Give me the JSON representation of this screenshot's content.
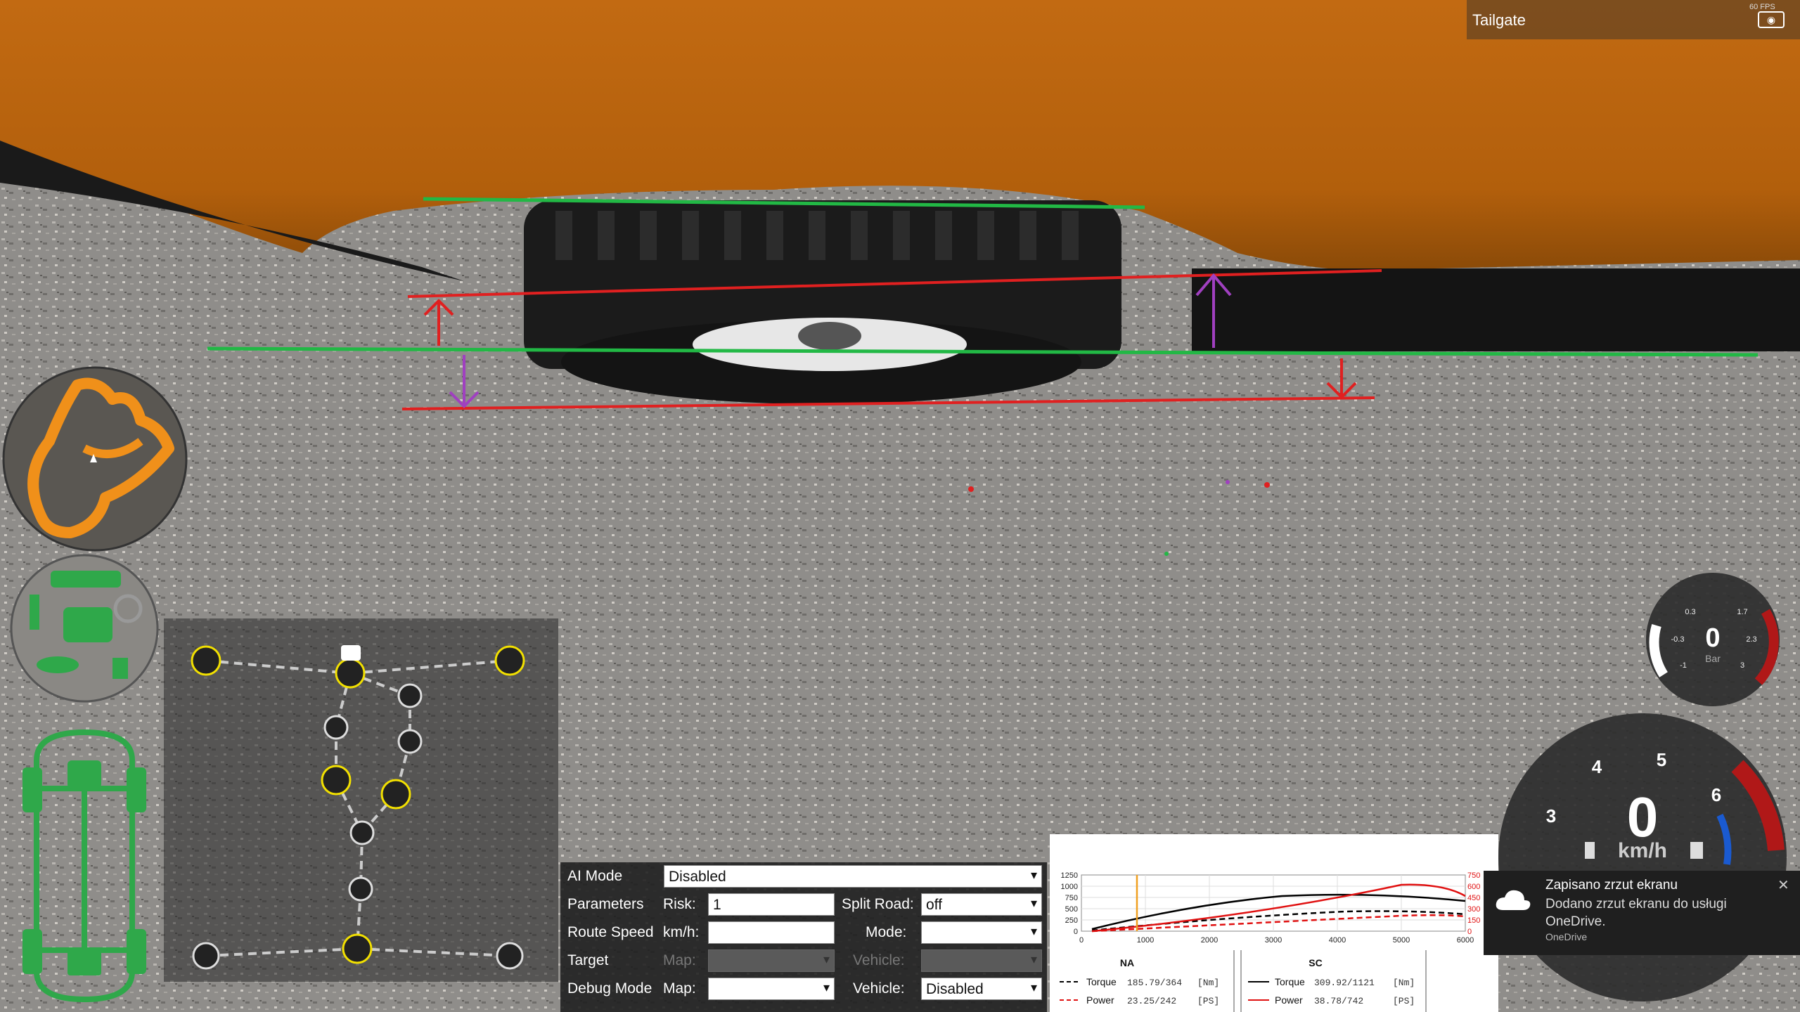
{
  "window": {
    "tailgate_label": "Tailgate",
    "fps_text": "60 FPS",
    "screenshot_icon": "camera-icon"
  },
  "debug_panel": {
    "ai_mode_label": "AI Mode",
    "ai_mode_value": "Disabled",
    "parameters_label": "Parameters",
    "risk_label": "Risk:",
    "risk_value": "1",
    "split_road_label": "Split Road:",
    "split_road_value": "off",
    "route_speed_label": "Route Speed",
    "kmh_label": "km/h:",
    "kmh_value": "",
    "mode_label": "Mode:",
    "mode_value": "",
    "target_label": "Target",
    "target_map_label": "Map:",
    "target_map_value": "",
    "target_vehicle_label": "Vehicle:",
    "target_vehicle_value": "",
    "debug_mode_label": "Debug Mode",
    "debug_map_label": "Map:",
    "debug_map_value": "",
    "debug_vehicle_label": "Vehicle:",
    "debug_vehicle_value": "Disabled"
  },
  "engine_chart": {
    "left_ticks": [
      "1250",
      "1000",
      "750",
      "500",
      "250",
      "0"
    ],
    "right_ticks": [
      "750",
      "600",
      "450",
      "300",
      "150",
      "0"
    ],
    "x_ticks": [
      "0",
      "1000",
      "2000",
      "3000",
      "4000",
      "5000",
      "6000"
    ],
    "na_title": "NA",
    "sc_title": "SC",
    "na_torque_label": "Torque",
    "na_torque_value": "185.79/364",
    "na_torque_unit": "[Nm]",
    "na_power_label": "Power",
    "na_power_value": "23.25/242",
    "na_power_unit": "[PS]",
    "sc_torque_label": "Torque",
    "sc_torque_value": "309.92/1121",
    "sc_torque_unit": "[Nm]",
    "sc_power_label": "Power",
    "sc_power_value": "38.78/742",
    "sc_power_unit": "[PS]",
    "colors": {
      "torque": "#000000",
      "power": "#e01010",
      "rpm_marker": "#f0a020"
    }
  },
  "toast": {
    "title": "Zapisano zrzut ekranu",
    "body": "Dodano zrzut ekranu do usługi OneDrive.",
    "app": "OneDrive",
    "close": "✕",
    "icon": "cloud-icon"
  },
  "boost_gauge": {
    "value": "0",
    "unit": "Bar",
    "ticks": [
      "0.3",
      "1.7",
      "-0.3",
      "2.3",
      "-1",
      "3"
    ]
  },
  "speed_gauge": {
    "value": "0",
    "unit": "km/h",
    "ticks": [
      "3",
      "4",
      "5",
      "6"
    ]
  },
  "hud_colors": {
    "map": "#f0901a",
    "powertrain": "#2fa84a",
    "node_ring": "#f2e000"
  }
}
